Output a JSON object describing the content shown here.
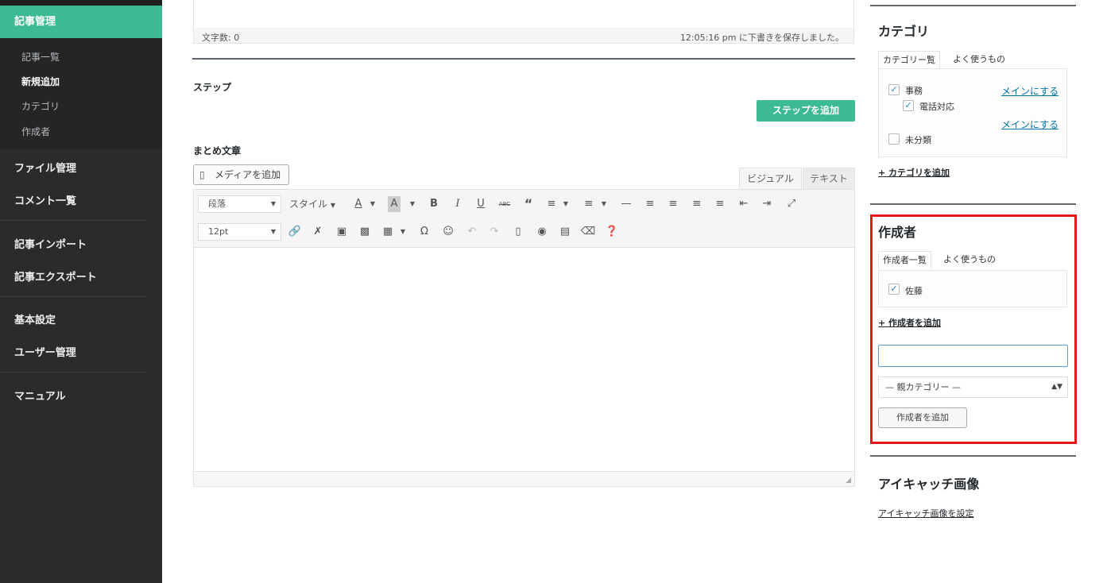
{
  "sidebar": {
    "active_section": "記事管理",
    "sub_items": [
      {
        "label": "記事一覧",
        "current": false
      },
      {
        "label": "新規追加",
        "current": true
      },
      {
        "label": "カテゴリ",
        "current": false
      },
      {
        "label": "作成者",
        "current": false
      }
    ],
    "items": [
      {
        "label": "ファイル管理"
      },
      {
        "label": "コメント一覧"
      },
      {
        "label": "記事インポート"
      },
      {
        "label": "記事エクスポート"
      },
      {
        "label": "基本設定"
      },
      {
        "label": "ユーザー管理"
      },
      {
        "label": "マニュアル"
      }
    ]
  },
  "editor_top": {
    "word_count": "文字数: 0",
    "draft_saved": "12:05:16 pm に下書きを保存しました。"
  },
  "steps": {
    "label": "ステップ",
    "add_button": "ステップを追加"
  },
  "summary": {
    "label": "まとめ文章",
    "media_button": "メディアを追加",
    "tab_visual": "ビジュアル",
    "tab_text": "テキスト",
    "format_select": "段落",
    "style_label": "スタイル",
    "font_size_select": "12pt"
  },
  "category_panel": {
    "title": "カテゴリ",
    "tab_all": "カテゴリー覧",
    "tab_popular": "よく使うもの",
    "items": [
      {
        "label": "事務",
        "checked": true,
        "make_main": "メインにする"
      },
      {
        "label": "電話対応",
        "checked": true,
        "make_main": "メインにする"
      },
      {
        "label": "未分類",
        "checked": false
      }
    ],
    "add_link": "+ カテゴリを追加"
  },
  "author_panel": {
    "title": "作成者",
    "tab_all": "作成者一覧",
    "tab_popular": "よく使うもの",
    "items": [
      {
        "label": "佐藤",
        "checked": true
      }
    ],
    "add_link": "+ 作成者を追加",
    "new_name_value": "",
    "parent_select": "— 親カテゴリー —",
    "add_button": "作成者を追加"
  },
  "eyecatch_panel": {
    "title": "アイキャッチ画像",
    "set_link": "アイキャッチ画像を設定"
  },
  "colors": {
    "accent": "#3cba93",
    "highlight_border": "#e11919",
    "sidebar_bg": "#2b2b2b"
  }
}
